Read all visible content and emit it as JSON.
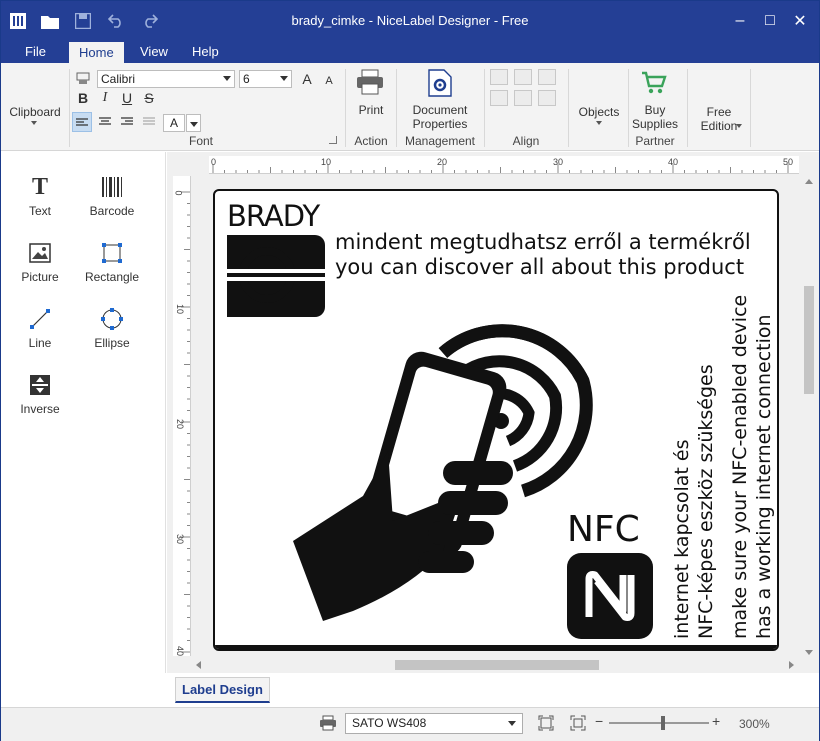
{
  "window": {
    "title": "brady_cimke - NiceLabel Designer - Free",
    "minimize": "–",
    "maximize": "□",
    "close": "✕"
  },
  "menu_tabs": [
    "File",
    "Home",
    "View",
    "Help"
  ],
  "active_menu_tab": "Home",
  "ribbon": {
    "clipboard_label": "Clipboard",
    "font_family": "Calibri",
    "font_size": "6",
    "font_group_label": "Font",
    "bold": "B",
    "italic": "I",
    "underline": "U",
    "strike": "S",
    "color_letter": "A",
    "print_label": "Print",
    "action_label": "Action",
    "doc_props_line1": "Document",
    "doc_props_line2": "Properties",
    "management_label": "Management",
    "align_label": "Align",
    "objects_label": "Objects",
    "buy_line1": "Buy",
    "buy_line2": "Supplies",
    "partner_label": "Partner",
    "free_line1": "Free",
    "free_line2": "Edition"
  },
  "toolbox": {
    "text": "Text",
    "barcode": "Barcode",
    "picture": "Picture",
    "rectangle": "Rectangle",
    "line": "Line",
    "ellipse": "Ellipse",
    "inverse": "Inverse"
  },
  "rulers": {
    "horizontal": [
      "0",
      "10",
      "20",
      "30",
      "40",
      "50"
    ],
    "vertical": [
      "0",
      "10",
      "20",
      "30",
      "40"
    ]
  },
  "label": {
    "brand": "BRADY",
    "line_hu": "mindent megtudhatsz erről a termékről",
    "line_en": "you can discover all about this product",
    "nfc": "NFC",
    "vert_hu_1": "internet kapcsolat és",
    "vert_hu_2": "NFC-képes eszköz szükséges",
    "vert_en_1": "make sure your NFC-enabled device",
    "vert_en_2": "has a working internet connection"
  },
  "bottom_tab": "Label Design",
  "status": {
    "printer": "SATO WS408",
    "zoom": "300%",
    "zoom_minus": "−",
    "zoom_plus": "+"
  }
}
